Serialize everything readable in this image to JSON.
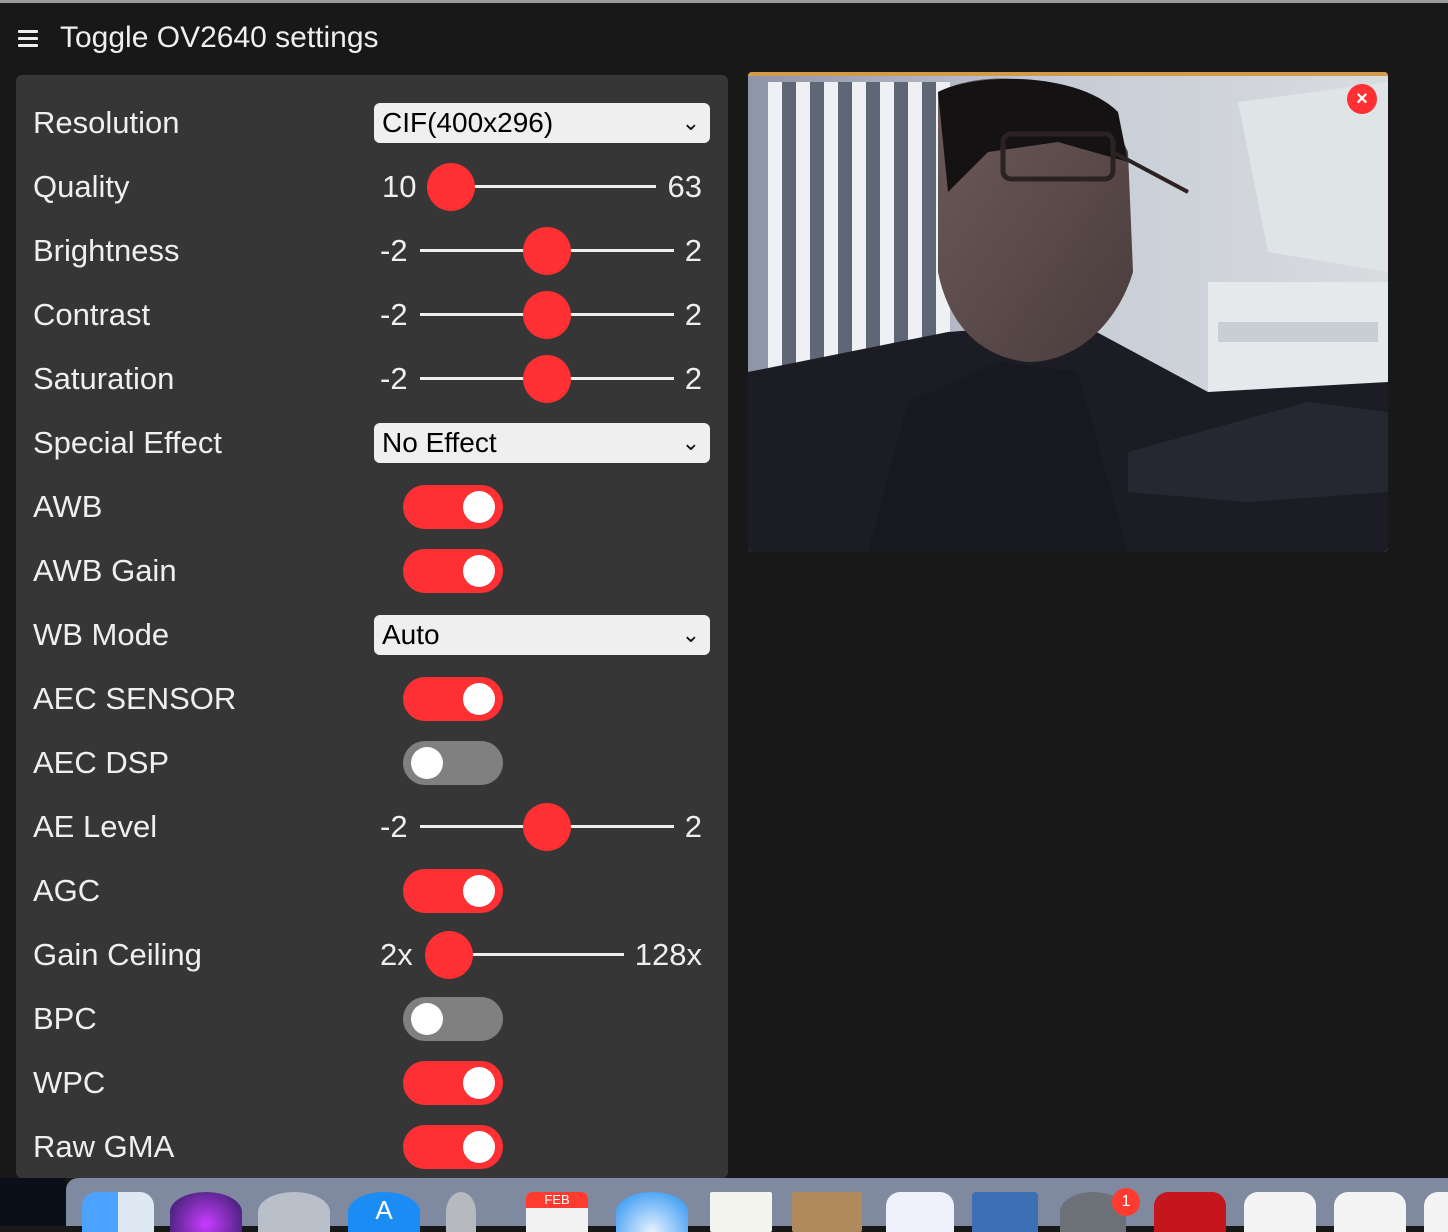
{
  "header": {
    "title": "Toggle OV2640 settings",
    "menu_icon": "hamburger-menu-icon"
  },
  "colors": {
    "accent": "#ff3034",
    "panel": "#363636",
    "background": "#181818",
    "text": "#efefef",
    "toggle_off": "#808080"
  },
  "settings": {
    "resolution": {
      "label": "Resolution",
      "value": "CIF(400x296)"
    },
    "quality": {
      "label": "Quality",
      "min": "10",
      "max": "63",
      "value": 10
    },
    "brightness": {
      "label": "Brightness",
      "min": "-2",
      "max": "2",
      "value": 0
    },
    "contrast": {
      "label": "Contrast",
      "min": "-2",
      "max": "2",
      "value": 0
    },
    "saturation": {
      "label": "Saturation",
      "min": "-2",
      "max": "2",
      "value": 0
    },
    "special_effect": {
      "label": "Special Effect",
      "value": "No Effect"
    },
    "awb": {
      "label": "AWB",
      "on": true
    },
    "awb_gain": {
      "label": "AWB Gain",
      "on": true
    },
    "wb_mode": {
      "label": "WB Mode",
      "value": "Auto"
    },
    "aec_sensor": {
      "label": "AEC SENSOR",
      "on": true
    },
    "aec_dsp": {
      "label": "AEC DSP",
      "on": false
    },
    "ae_level": {
      "label": "AE Level",
      "min": "-2",
      "max": "2",
      "value": 0
    },
    "agc": {
      "label": "AGC",
      "on": true
    },
    "gain_ceiling": {
      "label": "Gain Ceiling",
      "min": "2x",
      "max": "128x",
      "value": 0
    },
    "bpc": {
      "label": "BPC",
      "on": false
    },
    "wpc": {
      "label": "WPC",
      "on": true
    },
    "raw_gma": {
      "label": "Raw GMA",
      "on": true
    }
  },
  "stream": {
    "close_label": "×",
    "image": "camera-stream-image"
  },
  "dock": {
    "apps": [
      "finder-icon",
      "siri-icon",
      "launchpad-icon",
      "app-store-icon",
      "keychain-icon",
      "calendar-icon",
      "safari-icon",
      "textedit-icon",
      "preview-icon",
      "teams-icon",
      "virtualbox-icon",
      "system-preferences-icon",
      "acrobat-icon",
      "powerpoint-icon",
      "excel-icon",
      "word-icon"
    ],
    "calendar_month": "FEB",
    "system_preferences_badge": "1"
  }
}
